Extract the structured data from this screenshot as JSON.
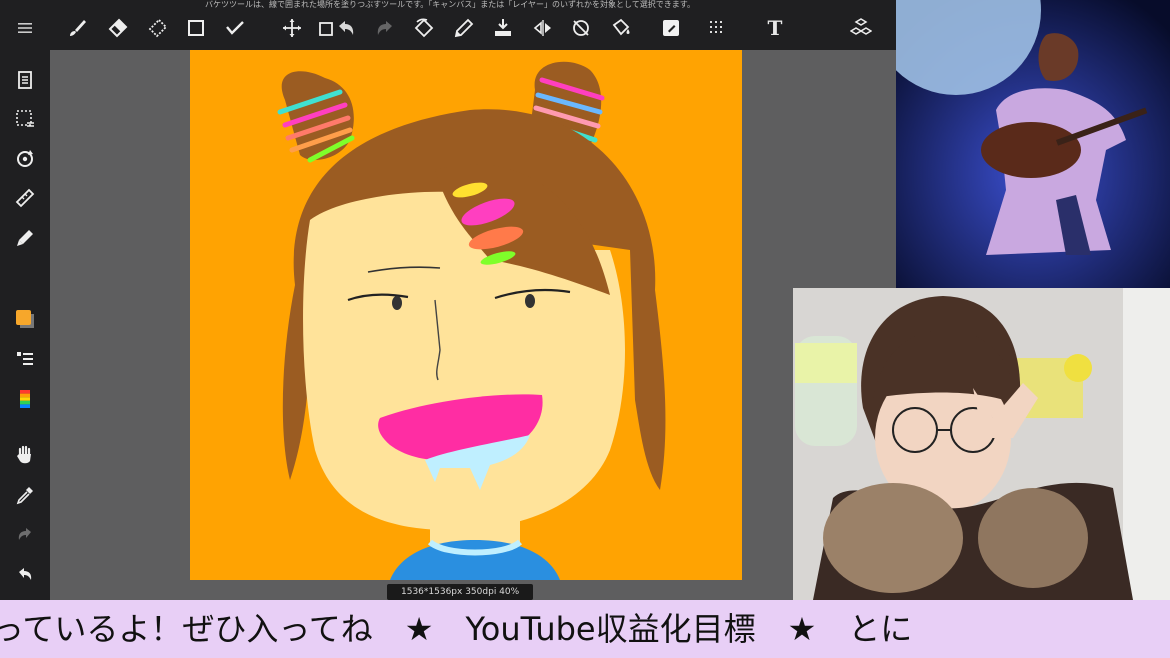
{
  "toolbar": {
    "hint_text": "バケツツールは、線で囲まれた場所を塗りつぶすツールです。「キャンバス」または「レイヤー」のいずれかを対象として選択できます。",
    "text_tool_label": "T",
    "tools": [
      {
        "name": "menu-icon"
      },
      {
        "name": "brush-icon"
      },
      {
        "name": "eraser-icon"
      },
      {
        "name": "blur-icon"
      },
      {
        "name": "rectangle-icon"
      },
      {
        "name": "check-icon"
      },
      {
        "name": "move-icon"
      },
      {
        "name": "transform-icon"
      },
      {
        "name": "undo-icon"
      },
      {
        "name": "redo-icon"
      },
      {
        "name": "rotate-icon"
      },
      {
        "name": "pen-icon"
      },
      {
        "name": "fill-icon"
      },
      {
        "name": "flip-icon"
      },
      {
        "name": "no-snap-icon"
      },
      {
        "name": "paint-bucket-icon"
      },
      {
        "name": "color-fill-icon"
      },
      {
        "name": "grid-icon"
      },
      {
        "name": "text-icon"
      },
      {
        "name": "materials-icon"
      }
    ]
  },
  "sidebar": {
    "tools": [
      {
        "name": "layers-page-icon"
      },
      {
        "name": "selection-icon"
      },
      {
        "name": "rotate-canvas-icon"
      },
      {
        "name": "ruler-icon"
      },
      {
        "name": "pen-settings-icon"
      },
      {
        "name": "color-swatch-icon"
      },
      {
        "name": "layer-list-icon"
      },
      {
        "name": "color-palette-icon"
      },
      {
        "name": "hand-icon"
      },
      {
        "name": "eyedropper-icon"
      },
      {
        "name": "redo-side-icon"
      },
      {
        "name": "undo-side-icon"
      }
    ],
    "current_color": "#f7a72b"
  },
  "canvas": {
    "background_color": "#ffa302",
    "status_text": "1536*1536px 350dpi 40%"
  },
  "ticker": {
    "text": "っているよ！ぜひ入ってね　★　YouTube収益化目標　★　とに"
  },
  "colors": {
    "toolbar_bg": "#1f1f21",
    "workspace_bg": "#5e5e5f",
    "ticker_bg": "#e8cff6"
  }
}
